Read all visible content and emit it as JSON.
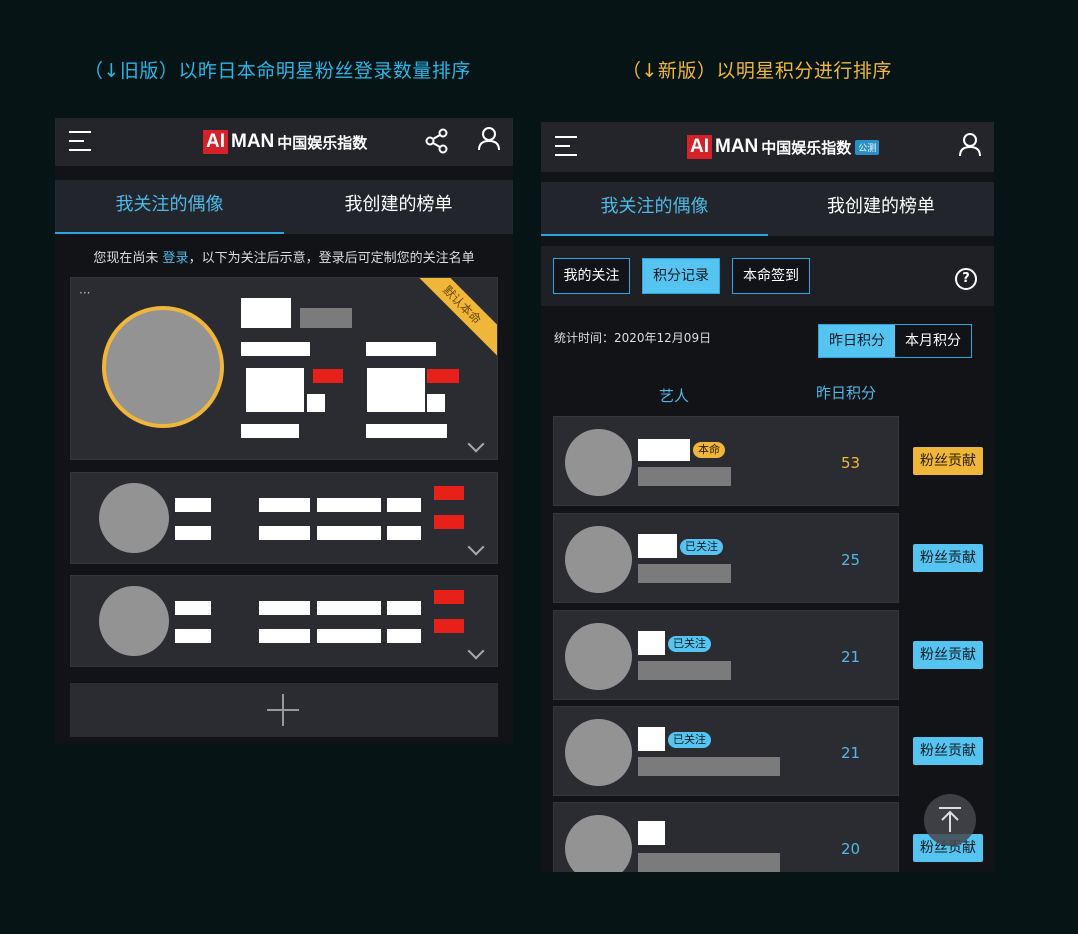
{
  "captions": {
    "old": "（↓旧版）以昨日本命明星粉丝登录数量排序",
    "new": "（↓新版）以明星积分进行排序"
  },
  "logo": {
    "ai": "AI",
    "man": "MAN",
    "cn": "中国娱乐指数",
    "beta": "公测"
  },
  "icons": {
    "menu": "menu-icon",
    "share": "share-icon",
    "user": "user-icon",
    "help": "help-icon",
    "chevron": "chevron-down-icon",
    "plus": "plus-icon",
    "back_to_top": "arrow-up-icon"
  },
  "colors": {
    "accent_blue": "#55c4f0",
    "accent_gold": "#f0b63a",
    "background": "#061416",
    "panel": "#2b2c31",
    "red": "#e8201a"
  },
  "old_ui": {
    "tabs": [
      "我关注的偶像",
      "我创建的榜单"
    ],
    "notice_prefix": "您现在尚未 ",
    "notice_link": "登录",
    "notice_suffix": "，以下为关注后示意，登录后可定制您的关注名单",
    "more": "···",
    "ribbon": "默认本命"
  },
  "new_ui": {
    "tabs": [
      "我关注的偶像",
      "我创建的榜单"
    ],
    "subtabs": [
      "我的关注",
      "积分记录",
      "本命签到"
    ],
    "help": "?",
    "stat_label": "统计时间：2020年12月09日",
    "seg": [
      "昨日积分",
      "本月积分"
    ],
    "col_artist": "艺人",
    "col_score": "昨日积分",
    "contrib_label": "粉丝贡献",
    "rows": [
      {
        "badge": "本命",
        "score": "53"
      },
      {
        "badge": "已关注",
        "score": "25"
      },
      {
        "badge": "已关注",
        "score": "21"
      },
      {
        "badge": "已关注",
        "score": "21"
      },
      {
        "badge": "",
        "score": "20"
      }
    ]
  }
}
